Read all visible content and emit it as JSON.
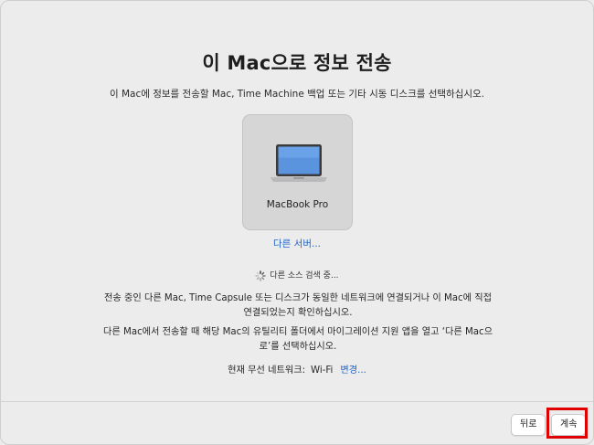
{
  "title": "이 Mac으로 정보 전송",
  "subtitle": "이 Mac에 정보를 전송할 Mac, Time Machine 백업 또는 기타 시동 디스크를 선택하십시오.",
  "device": {
    "name": "MacBook Pro",
    "icon": "laptop-icon"
  },
  "other_server_link": "다른 서버...",
  "search_status": "다른 소스 검색 중...",
  "instructions": [
    "전송 중인 다른 Mac, Time Capsule 또는 디스크가 동일한 네트워크에 연결되거나 이 Mac에 직접 연결되었는지 확인하십시오.",
    "다른 Mac에서 전송할 때 해당 Mac의 유틸리티 폴더에서 마이그레이션 지원 앱을 열고 ‘다른 Mac으로’를 선택하십시오."
  ],
  "network": {
    "label": "현재 무선 네트워크:",
    "value": "Wi-Fi",
    "change_link": "변경..."
  },
  "buttons": {
    "back": "뒤로",
    "continue": "계속"
  },
  "colors": {
    "link": "#1f63c6",
    "highlight": "#e00000",
    "background": "#ececec"
  }
}
